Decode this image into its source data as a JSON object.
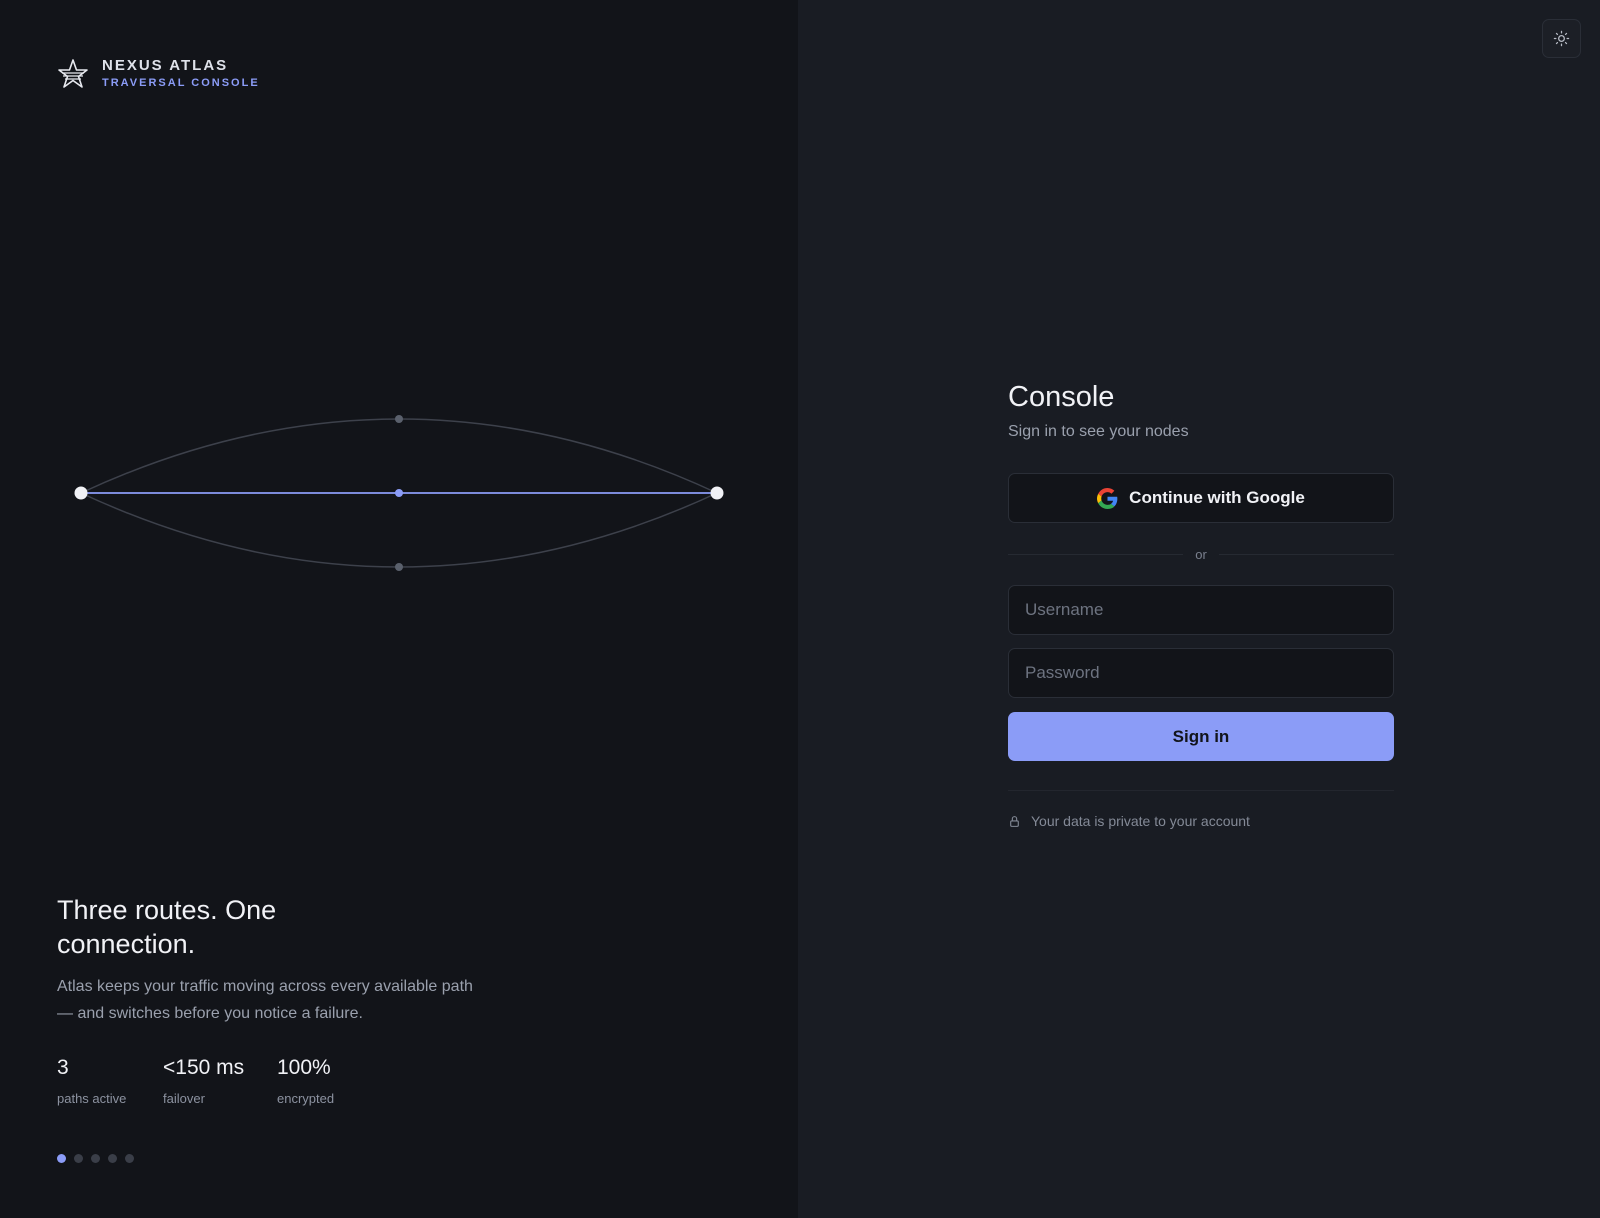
{
  "brand": {
    "name": "NEXUS ATLAS",
    "subtitle": "TRAVERSAL CONSOLE",
    "logo_icon": "star-burst-icon",
    "accent": "#8b9cf7"
  },
  "diagram": {
    "routes": [
      {
        "name": "upper",
        "active": false
      },
      {
        "name": "middle",
        "active": true
      },
      {
        "name": "lower",
        "active": false
      }
    ],
    "active_color": "#8b9cf7",
    "inactive_color": "#3d414b"
  },
  "hero": {
    "title": "Three routes. One connection.",
    "description": "Atlas keeps your traffic moving across every available path — and switches before you notice a failure.",
    "stats": [
      {
        "value": "3",
        "label": "paths active"
      },
      {
        "value": "<150 ms",
        "label": "failover"
      },
      {
        "value": "100%",
        "label": "encrypted"
      }
    ],
    "carousel": {
      "count": 5,
      "active_index": 0
    }
  },
  "theme_toggle": {
    "icon": "sun-icon"
  },
  "form": {
    "title": "Console",
    "subtitle": "Sign in to see your nodes",
    "google_label": "Continue with Google",
    "divider": "or",
    "username_placeholder": "Username",
    "password_placeholder": "Password",
    "submit_label": "Sign in",
    "privacy_text": "Your data is private to your account",
    "privacy_icon": "lock-icon",
    "button_color": "#8b9cf7"
  }
}
